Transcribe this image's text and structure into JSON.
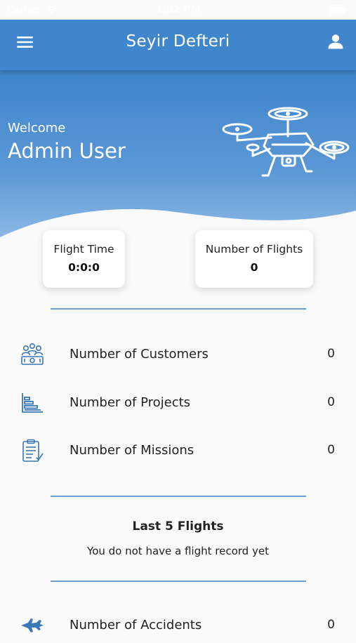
{
  "status": {
    "carrier": "Carrier",
    "time": "1:02 PM"
  },
  "header": {
    "title": "Seyir Defteri",
    "menu_icon": "hamburger-menu-icon",
    "user_icon": "user-icon"
  },
  "hero": {
    "welcome": "Welcome",
    "user_name": "Admin User"
  },
  "cards": [
    {
      "label": "Flight Time",
      "value": "0:0:0"
    },
    {
      "label": "Number of Flights",
      "value": "0"
    }
  ],
  "stats": [
    {
      "label": "Number of Customers",
      "value": "0",
      "icon": "customers-icon"
    },
    {
      "label": "Number of Projects",
      "value": "0",
      "icon": "projects-chart-icon"
    },
    {
      "label": "Number of Missions",
      "value": "0",
      "icon": "missions-clipboard-icon"
    }
  ],
  "last_flights": {
    "title": "Last 5 Flights",
    "empty_message": "You do not have a flight record yet"
  },
  "accidents": {
    "label": "Number of Accidents",
    "value": "0",
    "icon": "accident-icon"
  },
  "colors": {
    "primary": "#3f86cc",
    "divider": "#6b9fd4",
    "icon": "#3b78b8"
  }
}
